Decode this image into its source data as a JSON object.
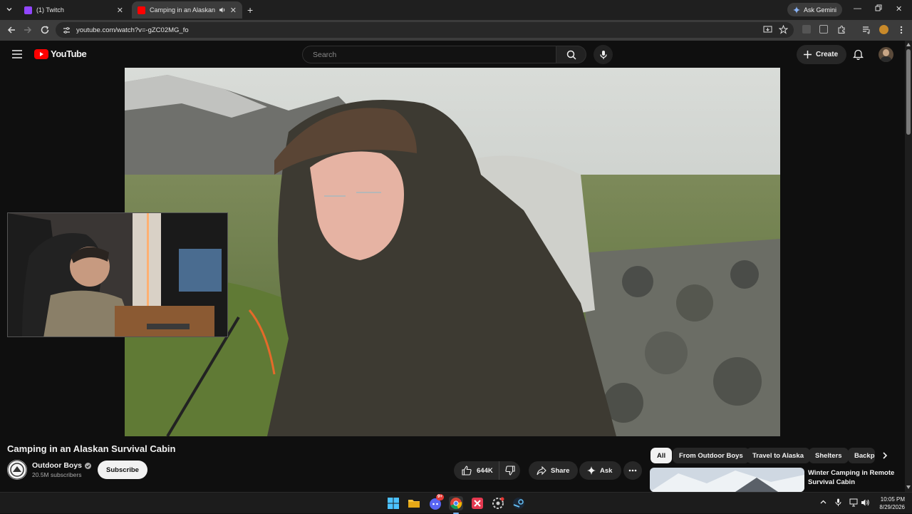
{
  "browser": {
    "tabs": [
      {
        "label": "(1) Twitch",
        "favicon_color": "#9146ff"
      },
      {
        "label": "Camping in an Alaskan Surv",
        "favicon_color": "#ff0000",
        "active": true
      }
    ],
    "ask_gemini": "Ask Gemini",
    "url": "youtube.com/watch?v=-gZC02MG_fo",
    "accent": "#3c3c3c"
  },
  "youtube": {
    "logo_text": "YouTube",
    "brand_color": "#ff0000",
    "search_placeholder": "Search",
    "create_label": "Create"
  },
  "video": {
    "title": "Camping in an Alaskan Survival Cabin",
    "channel": "Outdoor Boys",
    "subscribers": "20.5M subscribers",
    "subscribe_label": "Subscribe",
    "likes": "644K",
    "share_label": "Share",
    "ask_label": "Ask"
  },
  "chips": [
    "All",
    "From Outdoor Boys",
    "Travel to Alaska",
    "Shelters",
    "Backp"
  ],
  "recommendation": {
    "title": "Winter Camping in Remote Survival Cabin"
  },
  "taskbar": {
    "time": "10:05 PM",
    "date": "8/29/2026",
    "discord_badge": "9+"
  }
}
